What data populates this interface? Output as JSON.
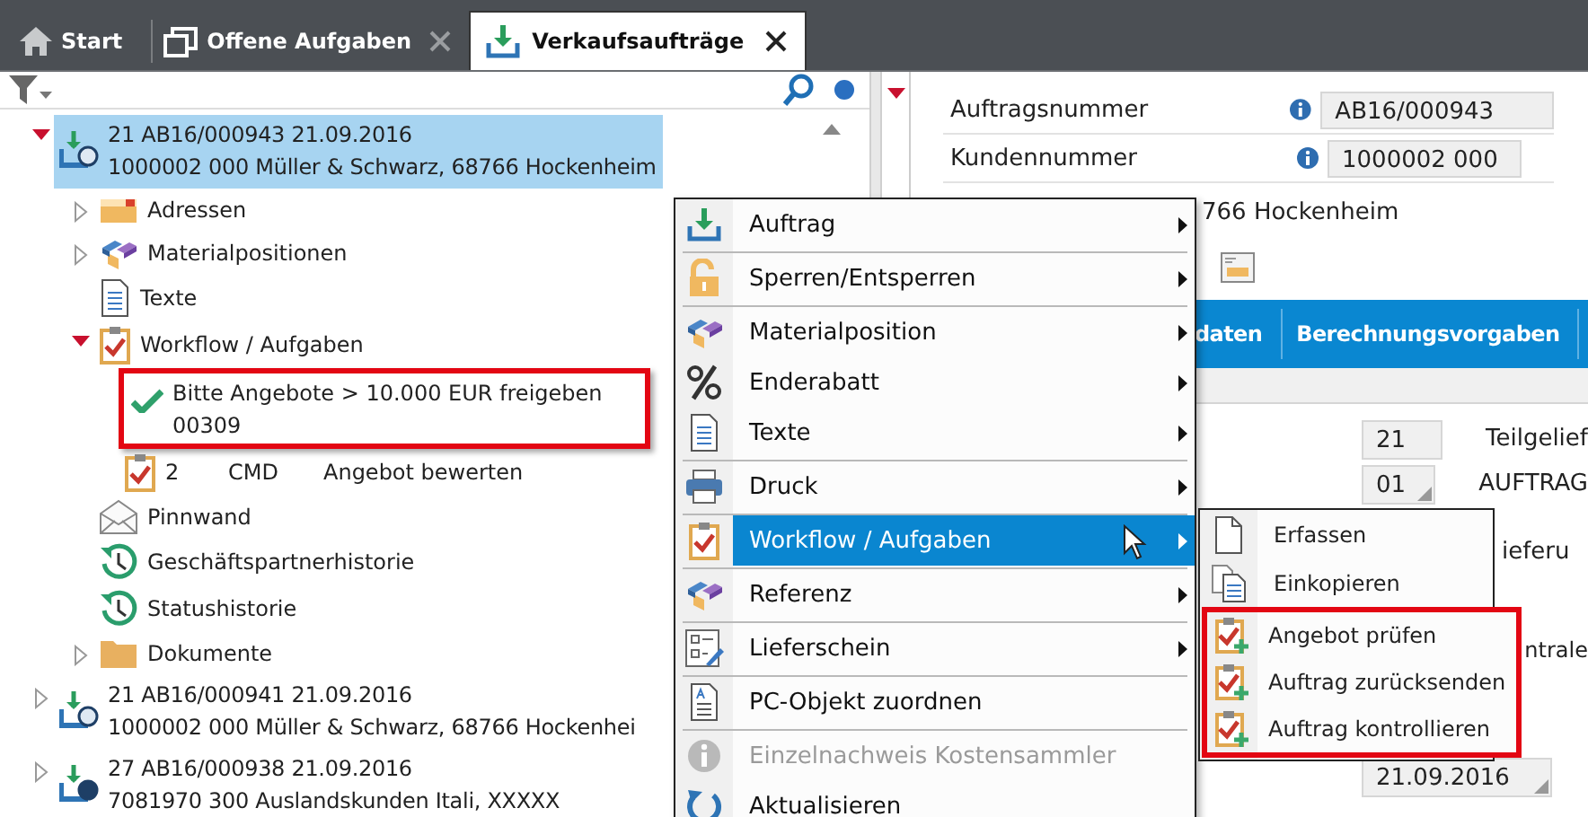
{
  "tabs": [
    {
      "label": "Start",
      "selected": false,
      "closable": false
    },
    {
      "label": "Offene Aufgaben",
      "selected": false,
      "closable": true
    },
    {
      "label": "Verkaufsaufträge",
      "selected": true,
      "closable": true
    }
  ],
  "tree": [
    {
      "title": "21 AB16/000943 21.09.2016",
      "subtitle": "1000002 000 Müller & Schwarz, 68766 Hockenheim",
      "expanded": true,
      "selected": true,
      "children": [
        {
          "label": "Adressen",
          "expanded": false,
          "selected": false
        },
        {
          "label": "Materialpositionen",
          "expanded": false,
          "selected": false
        },
        {
          "label": "Texte",
          "selected": false
        },
        {
          "label": "Workflow / Aufgaben",
          "expanded": true,
          "selected": false,
          "children": [
            {
              "kind": "done",
              "label": "Bitte Angebote > 10.000 EUR freigeben",
              "detail": "00309",
              "highlighted": true,
              "selected": false
            },
            {
              "kind": "open",
              "number": "2",
              "code": "CMD",
              "label": "Angebot bewerten",
              "highlighted": false,
              "selected": false
            }
          ]
        },
        {
          "label": "Pinnwand",
          "selected": false
        },
        {
          "label": "Geschäftspartnerhistorie",
          "selected": false
        },
        {
          "label": "Statushistorie",
          "selected": false
        },
        {
          "label": "Dokumente",
          "expanded": false,
          "selected": false
        }
      ]
    },
    {
      "title": "21 AB16/000941 21.09.2016",
      "subtitle": "1000002 000 Müller & Schwarz, 68766 Hockenhei",
      "expanded": false,
      "selected": false
    },
    {
      "title": "27 AB16/000938 21.09.2016",
      "subtitle": "7081970 300 Auslandskunden Itali, XXXXX",
      "expanded": false,
      "selected": false
    }
  ],
  "detail": {
    "fields": [
      {
        "label": "Auftragsnummer",
        "value": "AB16/000943"
      },
      {
        "label": "Kundennummer",
        "value": "1000002 000"
      }
    ],
    "address": "766 Hockenheim",
    "tabs": [
      {
        "label": "daten"
      },
      {
        "label": "Berechnungsvorgaben"
      }
    ],
    "form_rows": [
      {
        "value": "21",
        "label": "Teilgelief",
        "dropdown": false
      },
      {
        "value": "01",
        "label": "AUFTRAG",
        "dropdown": true
      },
      {
        "label": "ieferu"
      },
      {
        "label": "ntrale"
      },
      {
        "value": "21.09.2016",
        "dropdown": true
      }
    ]
  },
  "context_menu": {
    "groups": [
      {
        "items": [
          {
            "label": "Auftrag",
            "submenu": true,
            "disabled": false,
            "selected": false
          }
        ]
      },
      {
        "items": [
          {
            "label": "Sperren/Entsperren",
            "submenu": true,
            "disabled": false,
            "selected": false
          }
        ]
      },
      {
        "items": [
          {
            "label": "Materialposition",
            "submenu": true,
            "disabled": false,
            "selected": false
          },
          {
            "label": "Enderabatt",
            "submenu": true,
            "disabled": false,
            "selected": false
          },
          {
            "label": "Texte",
            "submenu": true,
            "disabled": false,
            "selected": false
          }
        ]
      },
      {
        "items": [
          {
            "label": "Druck",
            "submenu": true,
            "disabled": false,
            "selected": false
          }
        ]
      },
      {
        "items": [
          {
            "label": "Workflow / Aufgaben",
            "submenu": true,
            "disabled": false,
            "selected": true
          }
        ]
      },
      {
        "items": [
          {
            "label": "Referenz",
            "submenu": true,
            "disabled": false,
            "selected": false
          }
        ]
      },
      {
        "items": [
          {
            "label": "Lieferschein",
            "submenu": true,
            "disabled": false,
            "selected": false
          }
        ]
      },
      {
        "items": [
          {
            "label": "PC-Objekt zuordnen",
            "submenu": false,
            "disabled": false,
            "selected": false
          }
        ]
      },
      {
        "items": [
          {
            "label": "Einzelnachweis Kostensammler",
            "submenu": false,
            "disabled": true,
            "selected": false
          },
          {
            "label": "Aktualisieren",
            "submenu": false,
            "disabled": false,
            "selected": false
          }
        ]
      }
    ]
  },
  "submenu": {
    "items": [
      {
        "label": "Erfassen",
        "highlighted": false
      },
      {
        "label": "Einkopieren",
        "highlighted": false
      },
      {
        "label": "Angebot prüfen",
        "highlighted": true
      },
      {
        "label": "Auftrag zurücksenden",
        "highlighted": true
      },
      {
        "label": "Auftrag kontrollieren",
        "highlighted": true
      }
    ]
  }
}
